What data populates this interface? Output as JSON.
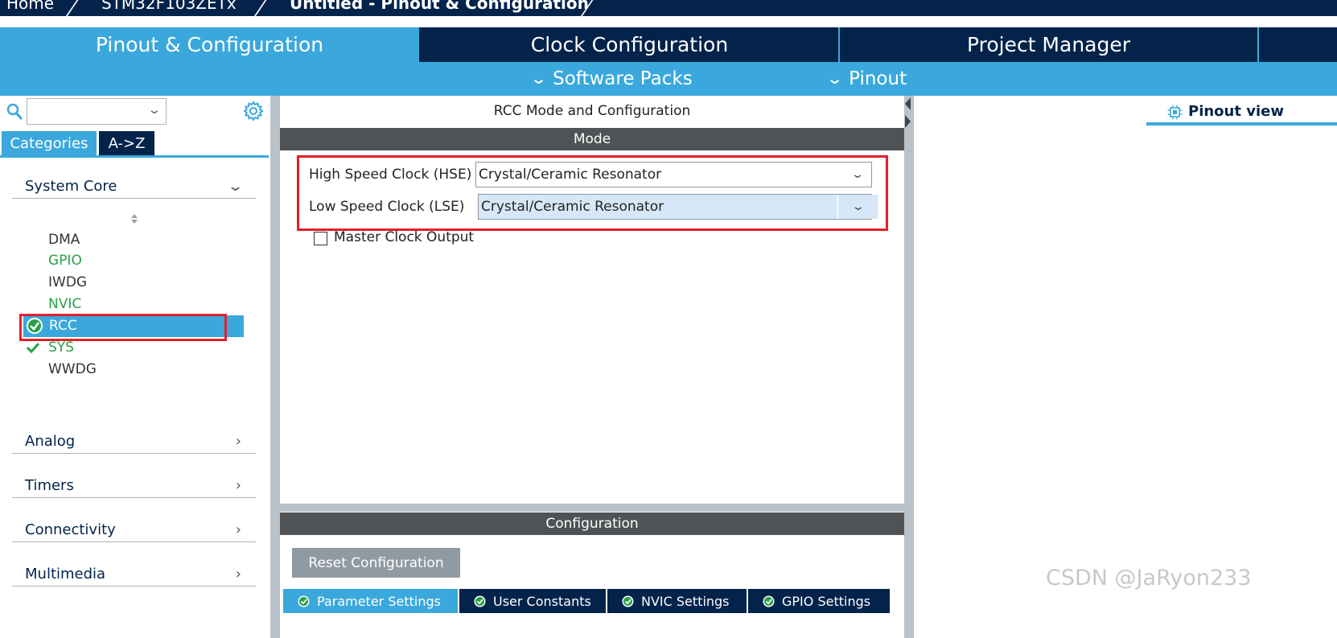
{
  "breadcrumbs": [
    "Home",
    "STM32F103ZETx",
    "Untitled - Pinout & Configuration"
  ],
  "main_tabs": [
    "Pinout & Configuration",
    "Clock Configuration",
    "Project Manager"
  ],
  "sub_menu": [
    "Software Packs",
    "Pinout"
  ],
  "left_panel": {
    "search_value": "",
    "view_tabs": [
      "Categories",
      "A->Z"
    ],
    "groups": {
      "system_core": "System Core",
      "analog": "Analog",
      "timers": "Timers",
      "connectivity": "Connectivity",
      "multimedia": "Multimedia"
    },
    "peripherals": [
      "DMA",
      "GPIO",
      "IWDG",
      "NVIC",
      "RCC",
      "SYS",
      "WWDG"
    ]
  },
  "center": {
    "title": "RCC Mode and Configuration",
    "mode_header": "Mode",
    "hse_label": "High Speed Clock (HSE)",
    "hse_value": "Crystal/Ceramic Resonator",
    "lse_label": "Low Speed Clock (LSE)",
    "lse_value": "Crystal/Ceramic Resonator",
    "mco_label": "Master Clock Output",
    "config_header": "Configuration",
    "reset_button": "Reset Configuration",
    "config_tabs": [
      "Parameter Settings",
      "User Constants",
      "NVIC Settings",
      "GPIO Settings"
    ]
  },
  "right_panel": {
    "view_tab": "Pinout view"
  },
  "watermark": "CSDN @JaRyon233",
  "colors": {
    "navy": "#03234b",
    "accent_blue": "#3aa8dc",
    "header_gray": "#4f5355",
    "green": "#27a048",
    "highlight_red": "#e3202b"
  }
}
